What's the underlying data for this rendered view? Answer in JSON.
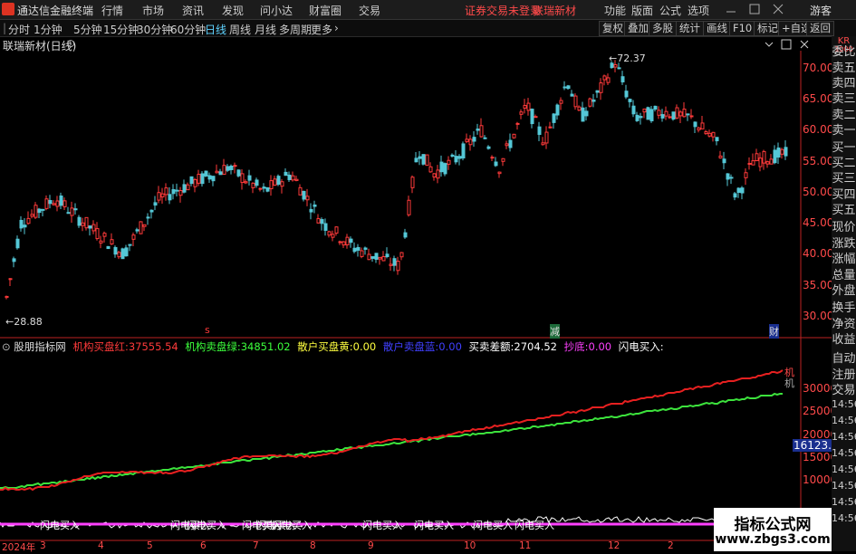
{
  "app": {
    "title": "通达信金融终端"
  },
  "menu": {
    "items": [
      "行情",
      "市场",
      "资讯",
      "发现",
      "问小达",
      "财富圈",
      "交易"
    ],
    "warning": "证券交易未登录",
    "stock": "联瑞新材",
    "right": [
      "功能",
      "版面",
      "公式",
      "选项"
    ],
    "user": "游客"
  },
  "periods": {
    "items": [
      "分时",
      "1分钟",
      "5分钟",
      "15分钟",
      "30分钟",
      "60分钟",
      "日线",
      "周线",
      "月线",
      "多周期",
      "更多"
    ],
    "active": "日线"
  },
  "toolbar_right": [
    "复权",
    "叠加",
    "多股",
    "统计",
    "画线",
    "F10",
    "标记",
    "+自选",
    "返回"
  ],
  "chart": {
    "title": "联瑞新材(日线)",
    "high_label": "72.37",
    "low_label": "28.88",
    "marker_s": "s",
    "marker_jian": "减",
    "marker_cai": "财",
    "price_ticks": [
      "70.00",
      "65.00",
      "60.00",
      "55.00",
      "50.00",
      "45.00",
      "40.00",
      "35.00",
      "30.00"
    ],
    "sub_ticks": [
      "30000",
      "25000",
      "20000",
      "15000",
      "10000"
    ],
    "sub_current": "16123.06",
    "sub_marker": "机"
  },
  "indicator": {
    "name": "股朋指标网",
    "items": [
      {
        "label": "机构买盘红:",
        "value": "37555.54",
        "color": "#ff3a3a"
      },
      {
        "label": "机构卖盘绿:",
        "value": "34851.02",
        "color": "#3cff3c"
      },
      {
        "label": "散户买盘黄:",
        "value": "0.00",
        "color": "#ffff40"
      },
      {
        "label": "散户卖盘蓝:",
        "value": "0.00",
        "color": "#4040ff"
      },
      {
        "label": "买卖差额:",
        "value": "2704.52",
        "color": "#ffffff"
      },
      {
        "label": "抄底:",
        "value": "0.00",
        "color": "#ff40ff"
      },
      {
        "label": "闪电买入:",
        "value": "",
        "color": "#ffffff"
      }
    ]
  },
  "flash_labels": [
    "闪电买入",
    "闪电买入",
    "闪电买入",
    "闪电买入",
    "闪电买入",
    "闪电买入",
    "闪电买入",
    "闪电买入",
    "闪电买入",
    "闪电买入"
  ],
  "xaxis": {
    "year": "2024年",
    "months": [
      "3",
      "4",
      "5",
      "6",
      "7",
      "8",
      "9",
      "10",
      "11",
      "12",
      "2",
      "3"
    ]
  },
  "sidebar": {
    "code": "KR",
    "code_sub": "1000",
    "items": [
      "委比",
      "卖五",
      "卖四",
      "卖三",
      "卖二",
      "卖一",
      "买一",
      "买二",
      "买三",
      "买四",
      "买五",
      "现价",
      "涨跌",
      "涨幅",
      "总量",
      "外盘",
      "换手",
      "净资",
      "收益",
      "自动",
      "注册",
      "交易",
      "14:56",
      "14:56",
      "14:56",
      "14:56",
      "14:56",
      "14:56",
      "14:56",
      "14:56"
    ]
  },
  "watermark": {
    "line1": "指标公式网",
    "line2": "www.zbgs3.com"
  },
  "colors": {
    "up": "#ff3a3a",
    "down": "#54c7d6",
    "red_line": "#e62020",
    "green_line": "#3ce23c",
    "magenta": "#ff40ff",
    "yellow": "#ffff00"
  }
}
